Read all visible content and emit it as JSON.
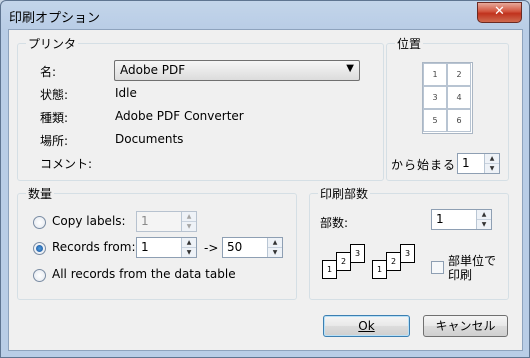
{
  "window": {
    "title": "印刷オプション",
    "close_symbol": "✕"
  },
  "printer": {
    "group_title": "プリンタ",
    "name_label": "名:",
    "name_value": "Adobe PDF",
    "status_label": "状態:",
    "status_value": "Idle",
    "type_label": "種類:",
    "type_value": "Adobe PDF Converter",
    "location_label": "場所:",
    "location_value": "Documents",
    "comment_label": "コメント:"
  },
  "position": {
    "group_title": "位置",
    "cells": [
      "1",
      "2",
      "3",
      "4",
      "5",
      "6"
    ],
    "start_label": "から始まる:",
    "start_value": "1"
  },
  "quantity": {
    "group_title": "数量",
    "copy_labels": "Copy labels:",
    "copy_value": "1",
    "records_from": "Records from:",
    "from_value": "1",
    "arrow": "->",
    "to_value": "50",
    "all_records": "All records from the data table",
    "selected": "records_from"
  },
  "copies": {
    "group_title": "印刷部数",
    "count_label": "部数:",
    "count_value": "1",
    "collate_label_1": "部単位で",
    "collate_label_2": "印刷",
    "collate_checked": false,
    "stack_pages": [
      "1",
      "2",
      "3"
    ]
  },
  "buttons": {
    "ok": "Ok",
    "cancel": "キャンセル"
  },
  "spinner": {
    "up": "▲",
    "down": "▼"
  }
}
